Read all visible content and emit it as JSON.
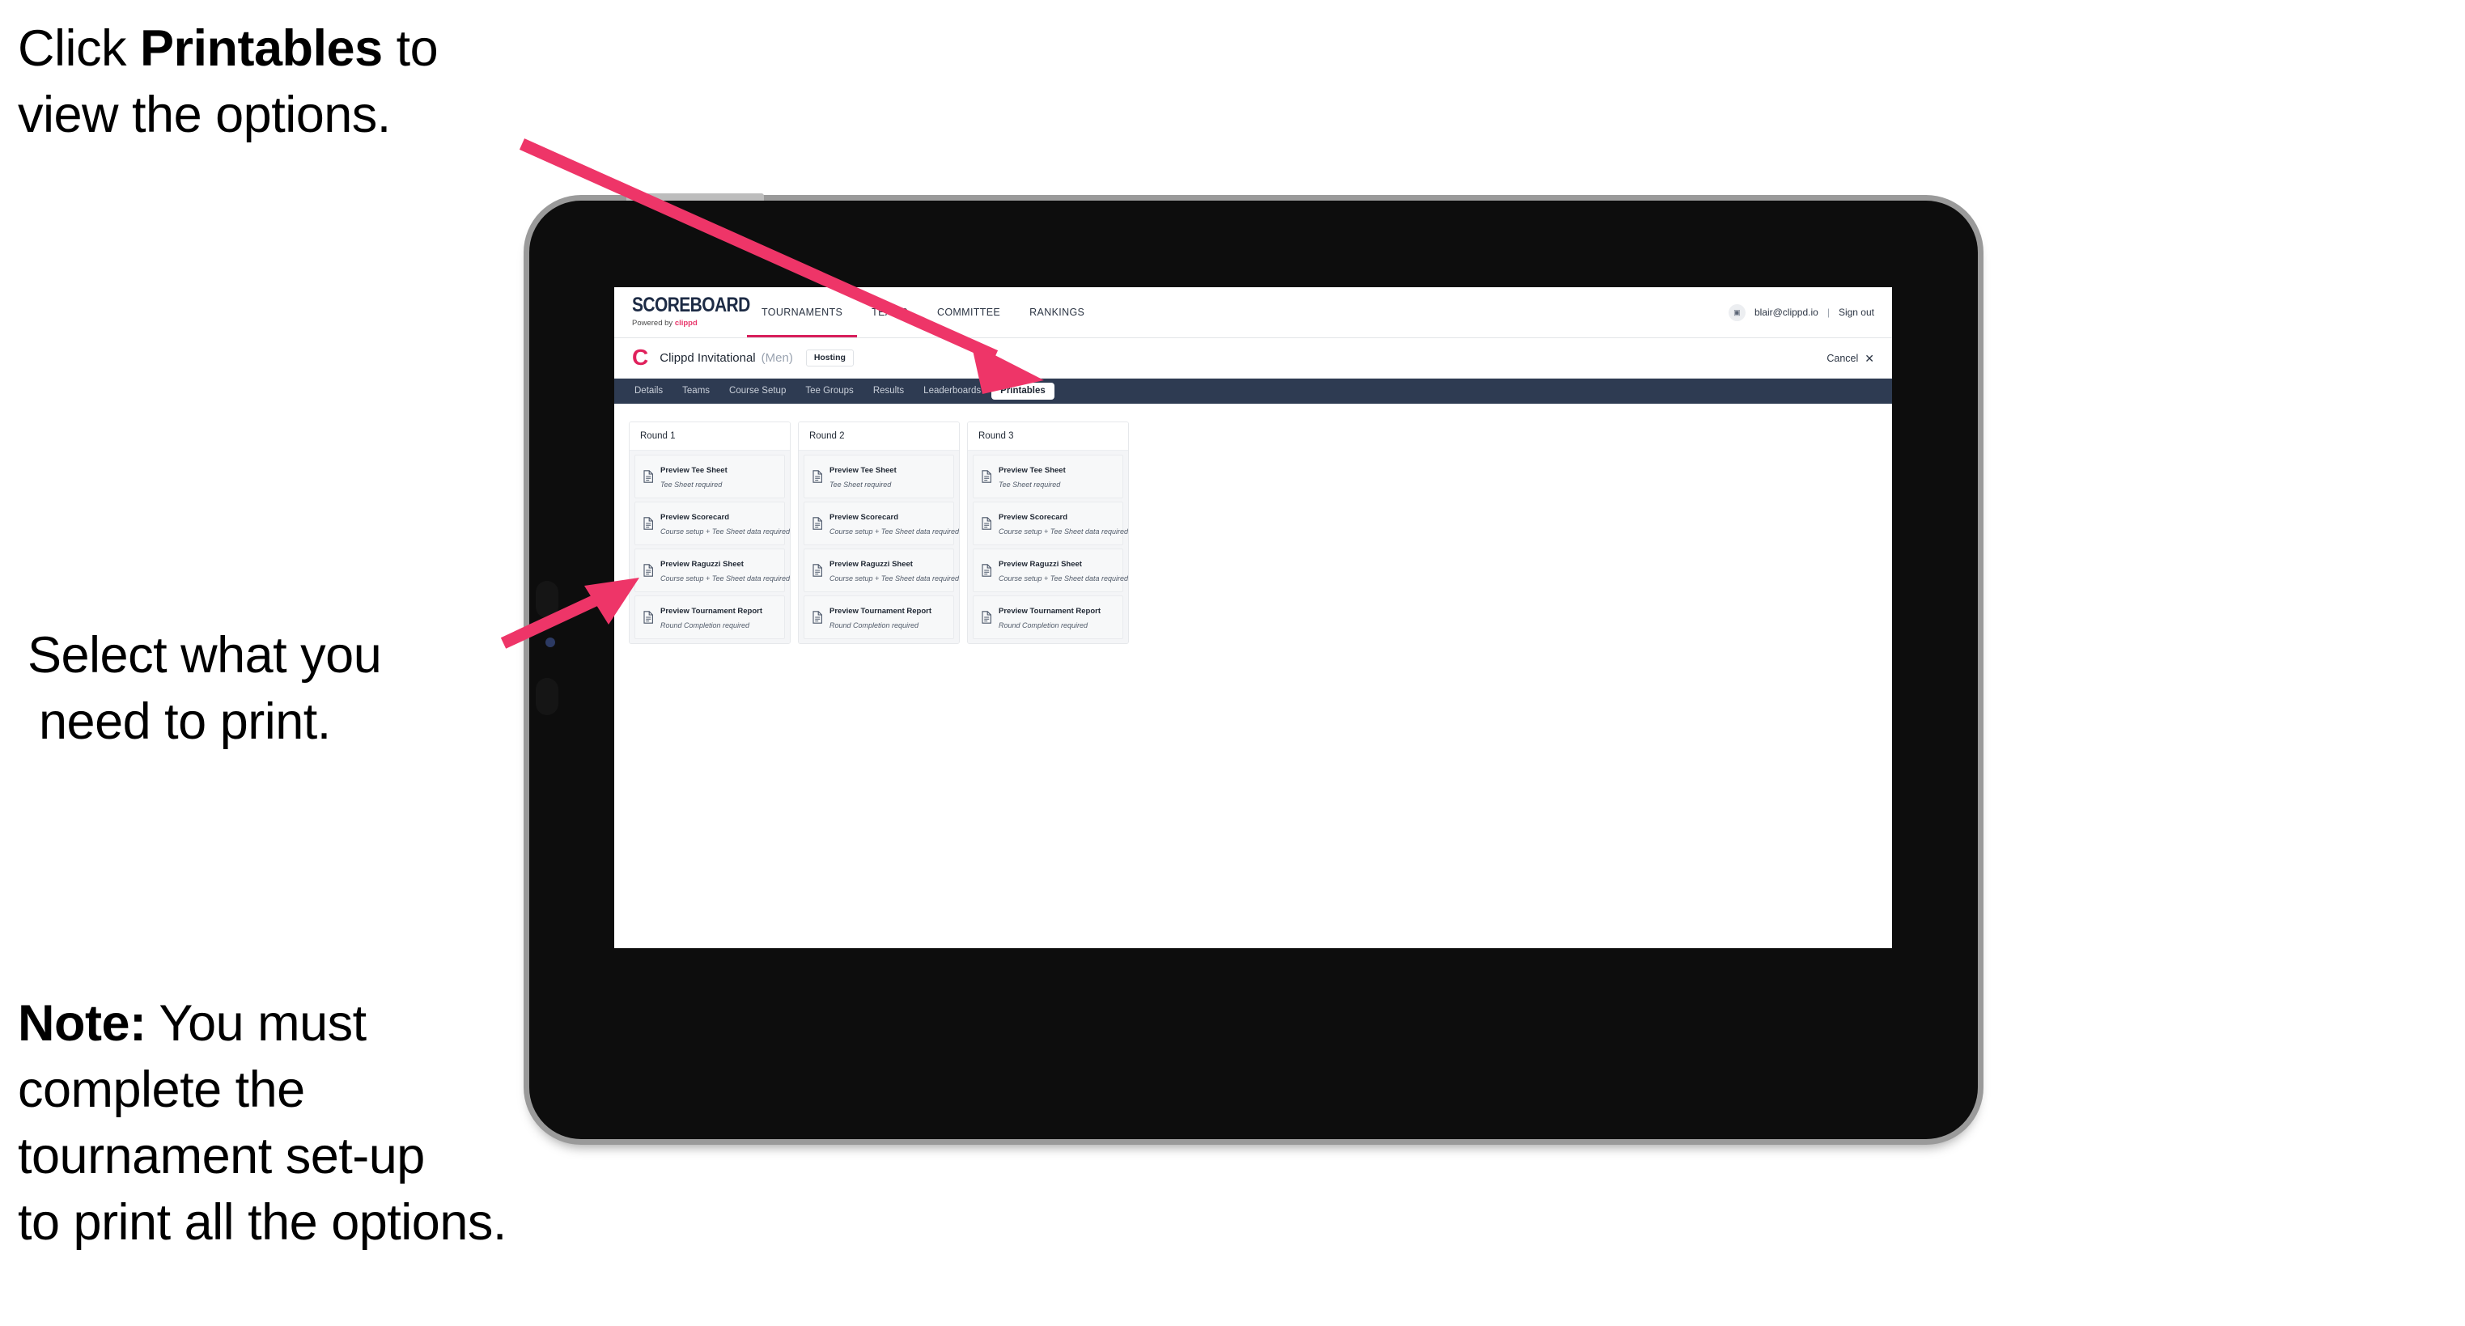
{
  "annotations": {
    "top": "Click |Printables| to\nview the options.",
    "top_plain_1": "Click ",
    "top_bold": "Printables",
    "top_plain_2": " to",
    "top_line2": "view the options.",
    "middle_line1": "Select what you",
    "middle_line2": "need to print.",
    "note_bold": "Note:",
    "note_rest": " You must\ncomplete the\ntournament set-up\nto print all the options."
  },
  "app": {
    "brand": {
      "wordmark": "SCOREBOARD",
      "powered_prefix": "Powered by ",
      "powered_brand": "clippd"
    },
    "top_nav": [
      {
        "label": "TOURNAMENTS",
        "active": true
      },
      {
        "label": "TEAMS",
        "active": false
      },
      {
        "label": "COMMITTEE",
        "active": false
      },
      {
        "label": "RANKINGS",
        "active": false
      }
    ],
    "account": {
      "avatar_glyph": "▣",
      "email": "blair@clippd.io",
      "separator": "|",
      "sign_out": "Sign out"
    },
    "tournament": {
      "logo_letter": "C",
      "title": "Clippd Invitational",
      "gender": "(Men)",
      "status_badge": "Hosting",
      "cancel_label": "Cancel",
      "cancel_icon": "✕"
    },
    "tabs": [
      {
        "label": "Details",
        "active": false
      },
      {
        "label": "Teams",
        "active": false
      },
      {
        "label": "Course Setup",
        "active": false
      },
      {
        "label": "Tee Groups",
        "active": false
      },
      {
        "label": "Results",
        "active": false
      },
      {
        "label": "Leaderboards",
        "active": false
      },
      {
        "label": "Printables",
        "active": true
      }
    ],
    "rounds": [
      {
        "heading": "Round 1",
        "items": [
          {
            "title": "Preview Tee Sheet",
            "requirement": "Tee Sheet required"
          },
          {
            "title": "Preview Scorecard",
            "requirement": "Course setup + Tee Sheet data required"
          },
          {
            "title": "Preview Raguzzi Sheet",
            "requirement": "Course setup + Tee Sheet data required"
          },
          {
            "title": "Preview Tournament Report",
            "requirement": "Round Completion required"
          }
        ]
      },
      {
        "heading": "Round 2",
        "items": [
          {
            "title": "Preview Tee Sheet",
            "requirement": "Tee Sheet required"
          },
          {
            "title": "Preview Scorecard",
            "requirement": "Course setup + Tee Sheet data required"
          },
          {
            "title": "Preview Raguzzi Sheet",
            "requirement": "Course setup + Tee Sheet data required"
          },
          {
            "title": "Preview Tournament Report",
            "requirement": "Round Completion required"
          }
        ]
      },
      {
        "heading": "Round 3",
        "items": [
          {
            "title": "Preview Tee Sheet",
            "requirement": "Tee Sheet required"
          },
          {
            "title": "Preview Scorecard",
            "requirement": "Course setup + Tee Sheet data required"
          },
          {
            "title": "Preview Raguzzi Sheet",
            "requirement": "Course setup + Tee Sheet data required"
          },
          {
            "title": "Preview Tournament Report",
            "requirement": "Round Completion required"
          }
        ]
      }
    ]
  },
  "colors": {
    "arrow_pink": "#EE3568",
    "accent_crimson": "#D81E5B",
    "tabstrip_navy": "#2E3B52",
    "clippd_red": "#E0215C"
  }
}
